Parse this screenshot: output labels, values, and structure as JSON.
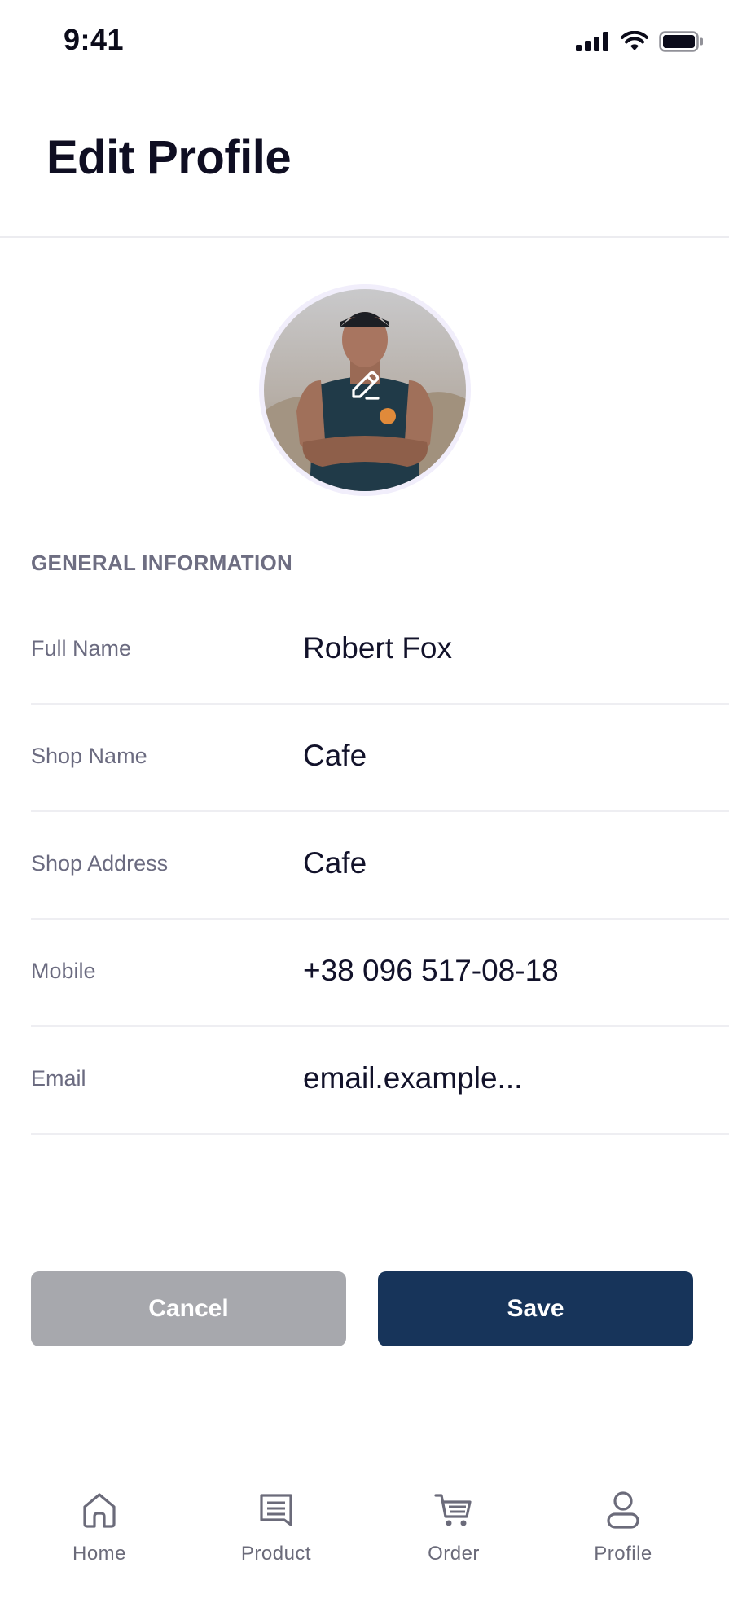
{
  "status_bar": {
    "time": "9:41"
  },
  "header": {
    "title": "Edit Profile"
  },
  "avatar": {
    "edit_icon": "pencil-icon"
  },
  "general_information": {
    "section_label": "GENERAL INFORMATION",
    "fields": [
      {
        "label": "Full Name",
        "value": "Robert Fox"
      },
      {
        "label": "Shop Name",
        "value": "Cafe"
      },
      {
        "label": "Shop Address",
        "value": "Cafe"
      },
      {
        "label": "Mobile",
        "value": "+38 096 517-08-18"
      },
      {
        "label": "Email",
        "value": "email.example..."
      }
    ]
  },
  "actions": {
    "cancel_label": "Cancel",
    "save_label": "Save"
  },
  "bottom_nav": {
    "items": [
      {
        "label": "Home",
        "icon": "home-icon"
      },
      {
        "label": "Product",
        "icon": "message-icon"
      },
      {
        "label": "Order",
        "icon": "cart-icon"
      },
      {
        "label": "Profile",
        "icon": "user-icon"
      }
    ]
  },
  "colors": {
    "primary": "#17345a",
    "disabled": "#a7a8ad",
    "text_dark": "#12122a",
    "text_muted": "#6b6b80"
  }
}
